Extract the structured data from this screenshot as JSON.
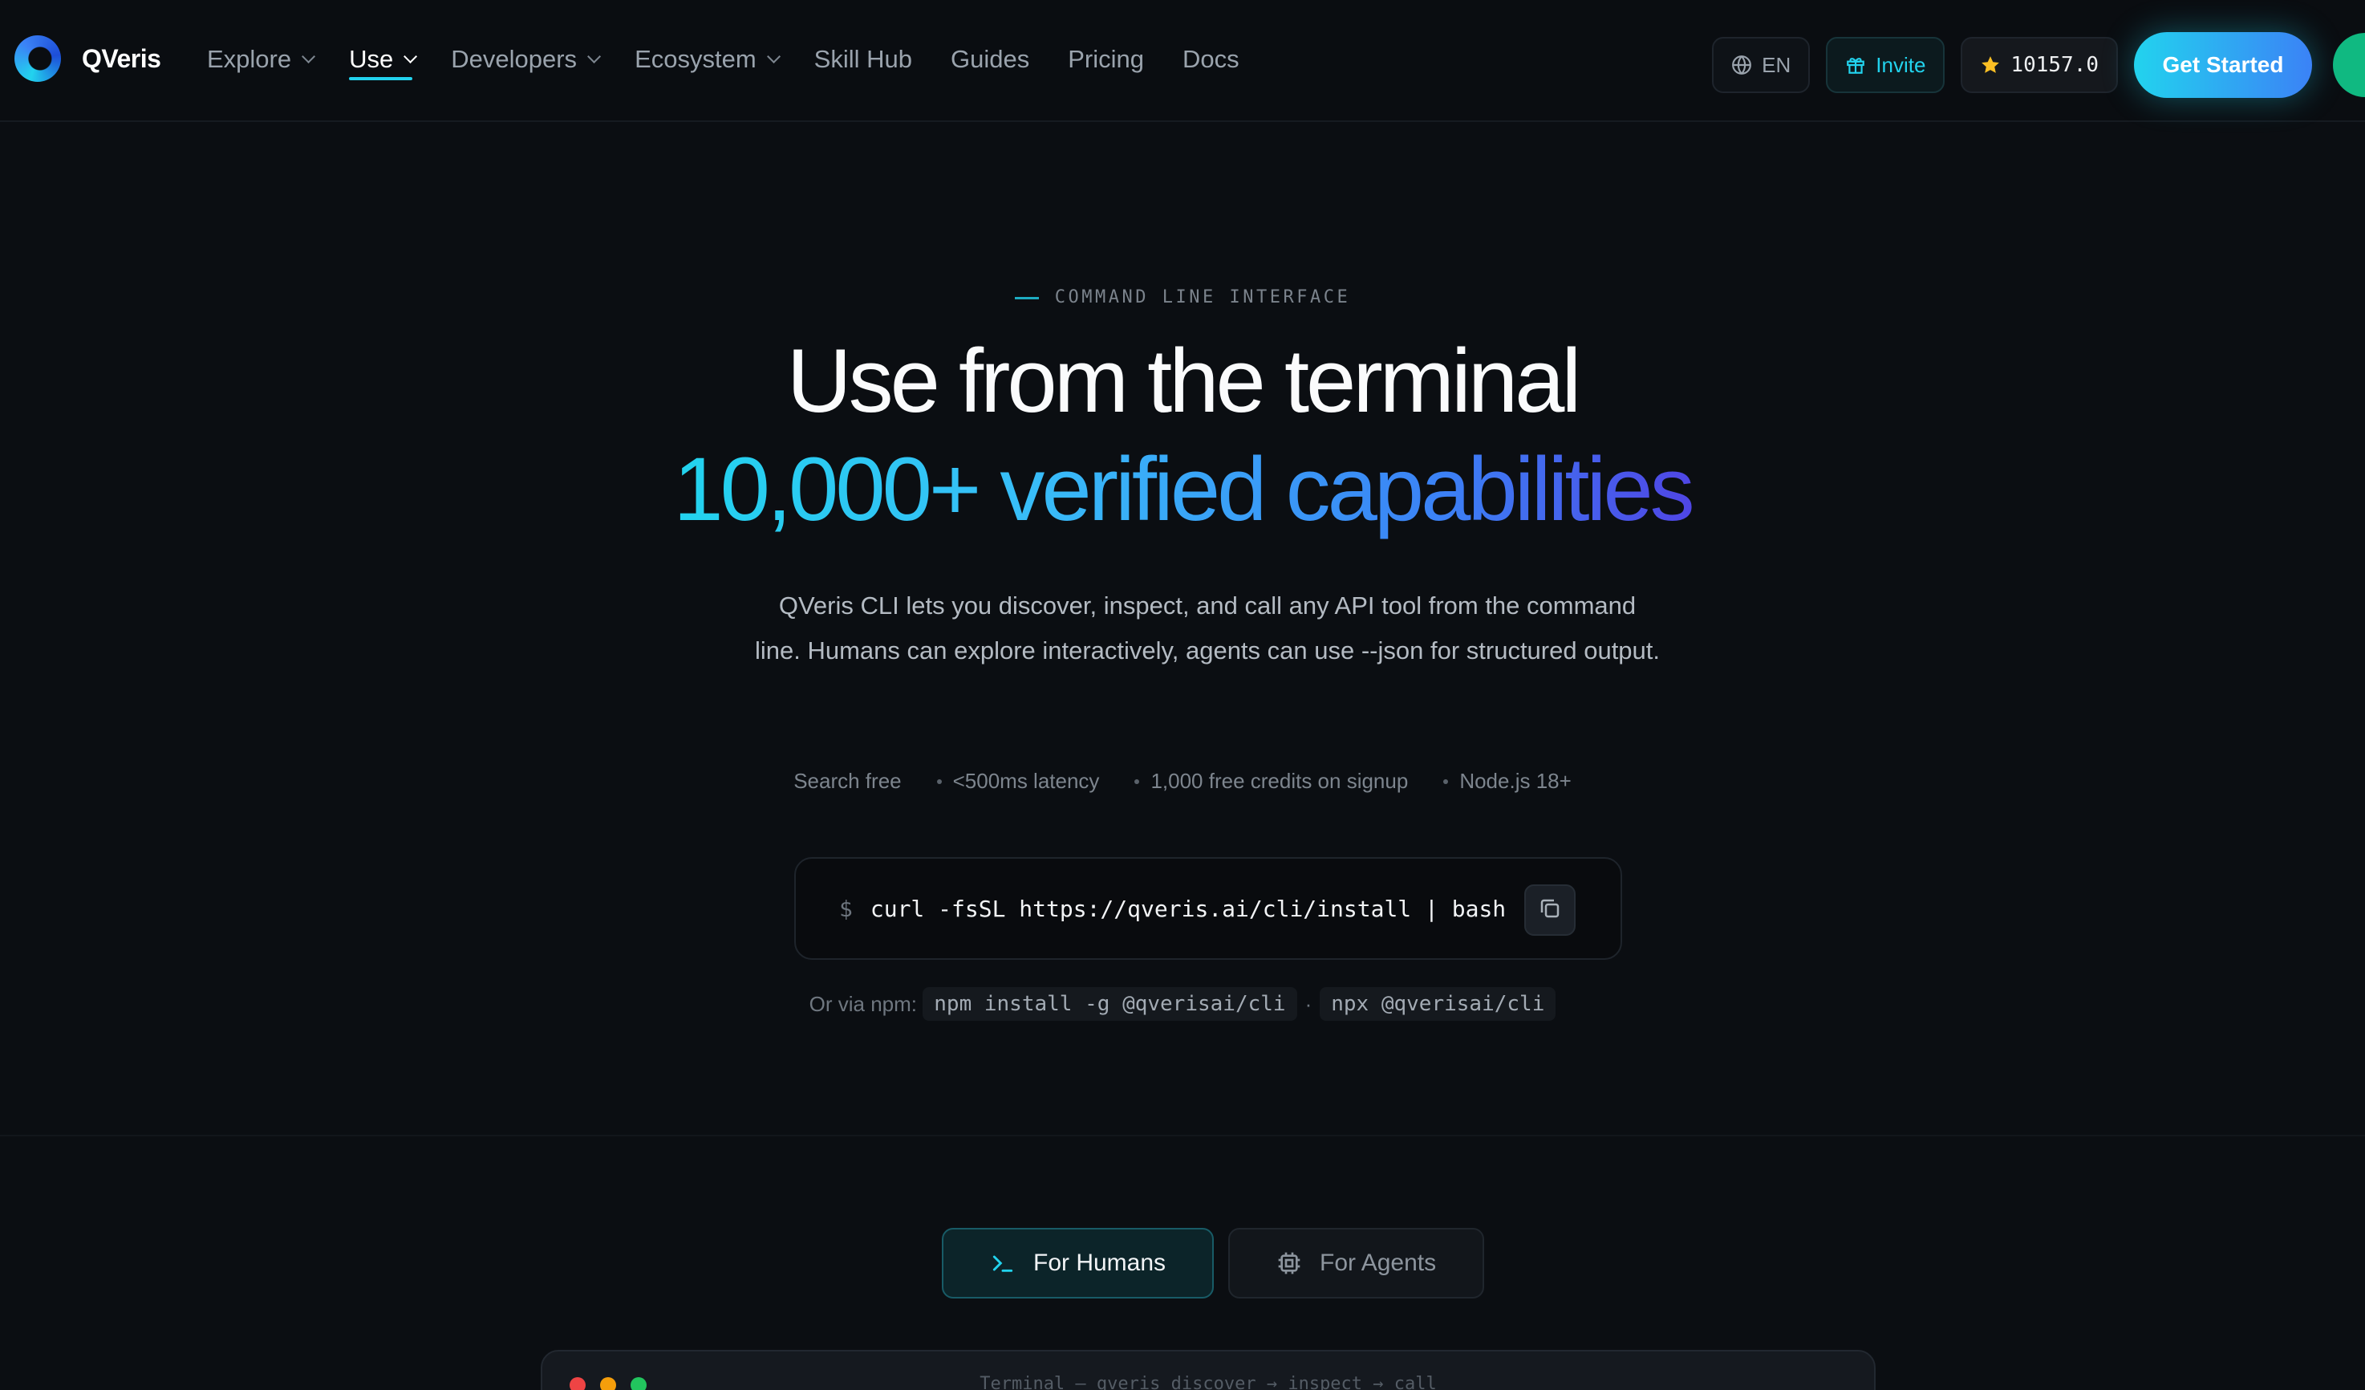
{
  "nav": {
    "brand": "QVeris",
    "items": [
      {
        "label": "Explore",
        "dropdown": true
      },
      {
        "label": "Use",
        "dropdown": true,
        "active": true
      },
      {
        "label": "Developers",
        "dropdown": true
      },
      {
        "label": "Ecosystem",
        "dropdown": true
      },
      {
        "label": "Skill Hub"
      },
      {
        "label": "Guides"
      },
      {
        "label": "Pricing"
      },
      {
        "label": "Docs"
      }
    ],
    "language": "EN",
    "invite": "Invite",
    "stars": "10157.0",
    "cta": "Get Started"
  },
  "hero": {
    "eyebrow": "COMMAND LINE INTERFACE",
    "title": "Use from the terminal",
    "title_gradient": "10,000+ verified capabilities",
    "lead": "QVeris CLI lets you discover, inspect, and call any API tool from the command line. Humans can explore interactively, agents can use --json for structured output.",
    "facts": [
      "Search free",
      "<500ms latency",
      "1,000 free credits on signup",
      "Node.js 18+"
    ],
    "install": {
      "prompt": "$",
      "command": "curl -fsSL https://qveris.ai/cli/install | bash"
    },
    "npm": {
      "label": "Or via npm:",
      "option1": "npm install -g @qverisai/cli",
      "separator": "·",
      "option2": "npx @qverisai/cli"
    }
  },
  "tabs": [
    {
      "label": "For Humans",
      "icon": "terminal-prompt-icon",
      "active": true
    },
    {
      "label": "For Agents",
      "icon": "cpu-chip-icon",
      "active": false
    }
  ],
  "terminal": {
    "title": "Terminal — qveris discover → inspect → call"
  },
  "colors": {
    "background": "#0b0e12",
    "accent_cyan": "#22d3ee",
    "accent_blue": "#3b82f6",
    "dot_red": "#ef4444",
    "dot_yellow": "#f59e0b",
    "dot_green": "#22c55e"
  }
}
